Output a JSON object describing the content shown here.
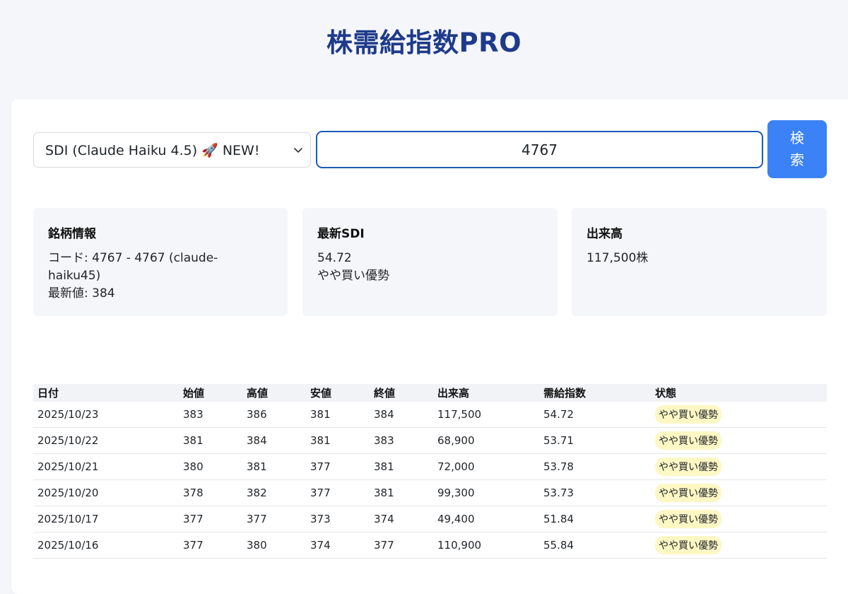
{
  "title": "株需給指数PRO",
  "controls": {
    "model_select_value": "SDI (Claude Haiku 4.5) 🚀 NEW!",
    "code_input_value": "4767",
    "search_label_line1": "検",
    "search_label_line2": "索"
  },
  "info": {
    "stock": {
      "title": "銘柄情報",
      "code_line_a": "コード: 4767 - 4767 (claude-",
      "code_line_b": "haiku45)",
      "latest_value": "最新値: 384"
    },
    "sdi": {
      "title": "最新SDI",
      "value": "54.72",
      "status": "やや買い優勢"
    },
    "volume": {
      "title": "出来高",
      "value": "117,500株"
    }
  },
  "table": {
    "headers": [
      "日付",
      "始値",
      "高値",
      "安値",
      "終値",
      "出来高",
      "需給指数",
      "状態"
    ],
    "rows": [
      [
        "2025/10/23",
        "383",
        "386",
        "381",
        "384",
        "117,500",
        "54.72",
        "やや買い優勢"
      ],
      [
        "2025/10/22",
        "381",
        "384",
        "381",
        "383",
        "68,900",
        "53.71",
        "やや買い優勢"
      ],
      [
        "2025/10/21",
        "380",
        "381",
        "377",
        "381",
        "72,000",
        "53.78",
        "やや買い優勢"
      ],
      [
        "2025/10/20",
        "378",
        "382",
        "377",
        "381",
        "99,300",
        "53.73",
        "やや買い優勢"
      ],
      [
        "2025/10/17",
        "377",
        "377",
        "373",
        "374",
        "49,400",
        "51.84",
        "やや買い優勢"
      ],
      [
        "2025/10/16",
        "377",
        "380",
        "374",
        "377",
        "110,900",
        "55.84",
        "やや買い優勢"
      ]
    ]
  },
  "colors": {
    "title": "#1e3a8a",
    "button": "#3b82f6",
    "status_text": "#cc8a10",
    "badge_bg": "#fdf7c4"
  }
}
